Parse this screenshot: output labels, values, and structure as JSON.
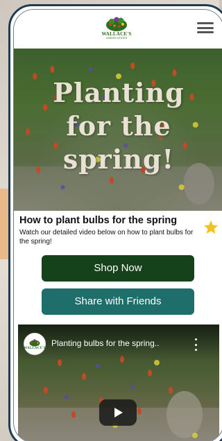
{
  "header": {
    "logo_text": "WALLACE'S",
    "logo_sub": "GARDEN CENTER",
    "menu_icon": "hamburger-menu-icon"
  },
  "hero": {
    "title_lines": [
      "Planting",
      "for the",
      "spring!"
    ]
  },
  "article": {
    "title": "How to plant bulbs for the spring",
    "description": "Watch our detailed video below on how to plant bulbs for the spring!",
    "favorite_icon": "star-icon",
    "star_color": "#f2c418"
  },
  "buttons": {
    "shop_label": "Shop Now",
    "share_label": "Share with Friends",
    "shop_color": "#15421a",
    "share_color": "#1e6e6b"
  },
  "video": {
    "title": "Planting bulbs for the spring..",
    "channel_logo_text": "WALLACE'S",
    "channel_logo_sub": "GARDEN CENTER",
    "more_icon": "more-vertical-icon",
    "play_icon": "play-icon"
  }
}
